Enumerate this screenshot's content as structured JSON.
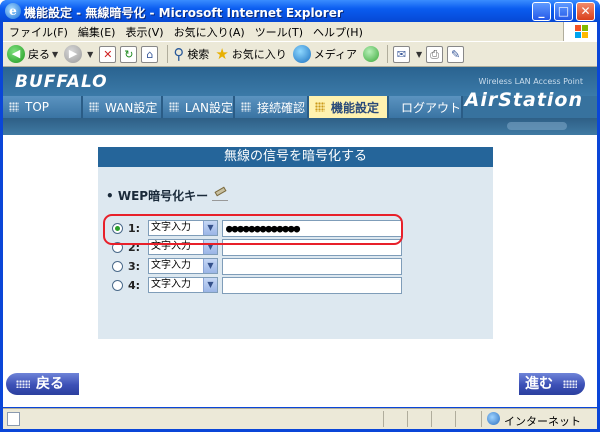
{
  "window": {
    "title": "機能設定 - 無線暗号化 - Microsoft Internet Explorer",
    "app_icon_glyph": "e",
    "buttons": {
      "minimize": "_",
      "maximize": "□",
      "close": "✕"
    }
  },
  "menubar": {
    "items": [
      "ファイル(F)",
      "編集(E)",
      "表示(V)",
      "お気に入り(A)",
      "ツール(T)",
      "ヘルプ(H)"
    ]
  },
  "toolbar": {
    "back": "戻る",
    "search": "検索",
    "favorites": "お気に入り",
    "media": "メディア"
  },
  "header": {
    "brand": "BUFFALO",
    "product_line": "Wireless LAN Access Point",
    "product": "AirStation",
    "nav": [
      "TOP",
      "WAN設定",
      "LAN設定",
      "接続確認",
      "機能設定",
      "ログアウト"
    ],
    "active_nav": "機能設定"
  },
  "panel": {
    "title": "無線の信号を暗号化する",
    "wep_label": "WEP暗号化キー",
    "keys": [
      {
        "number": "1:",
        "mode": "文字入力",
        "value": "●●●●●●●●●●●●●",
        "selected": true
      },
      {
        "number": "2:",
        "mode": "文字入力",
        "value": "",
        "selected": false
      },
      {
        "number": "3:",
        "mode": "文字入力",
        "value": "",
        "selected": false
      },
      {
        "number": "4:",
        "mode": "文字入力",
        "value": "",
        "selected": false
      }
    ]
  },
  "footer_nav": {
    "back": "戻る",
    "next": "進む"
  },
  "statusbar": {
    "zone": "インターネット"
  },
  "colors": {
    "header_blue": "#37729e",
    "panel_title_blue": "#25659a",
    "panel_bg": "#dde8f0",
    "active_tab": "#fff2b0",
    "highlight_red": "#e8202a",
    "nav_button": "#3c50b6"
  }
}
